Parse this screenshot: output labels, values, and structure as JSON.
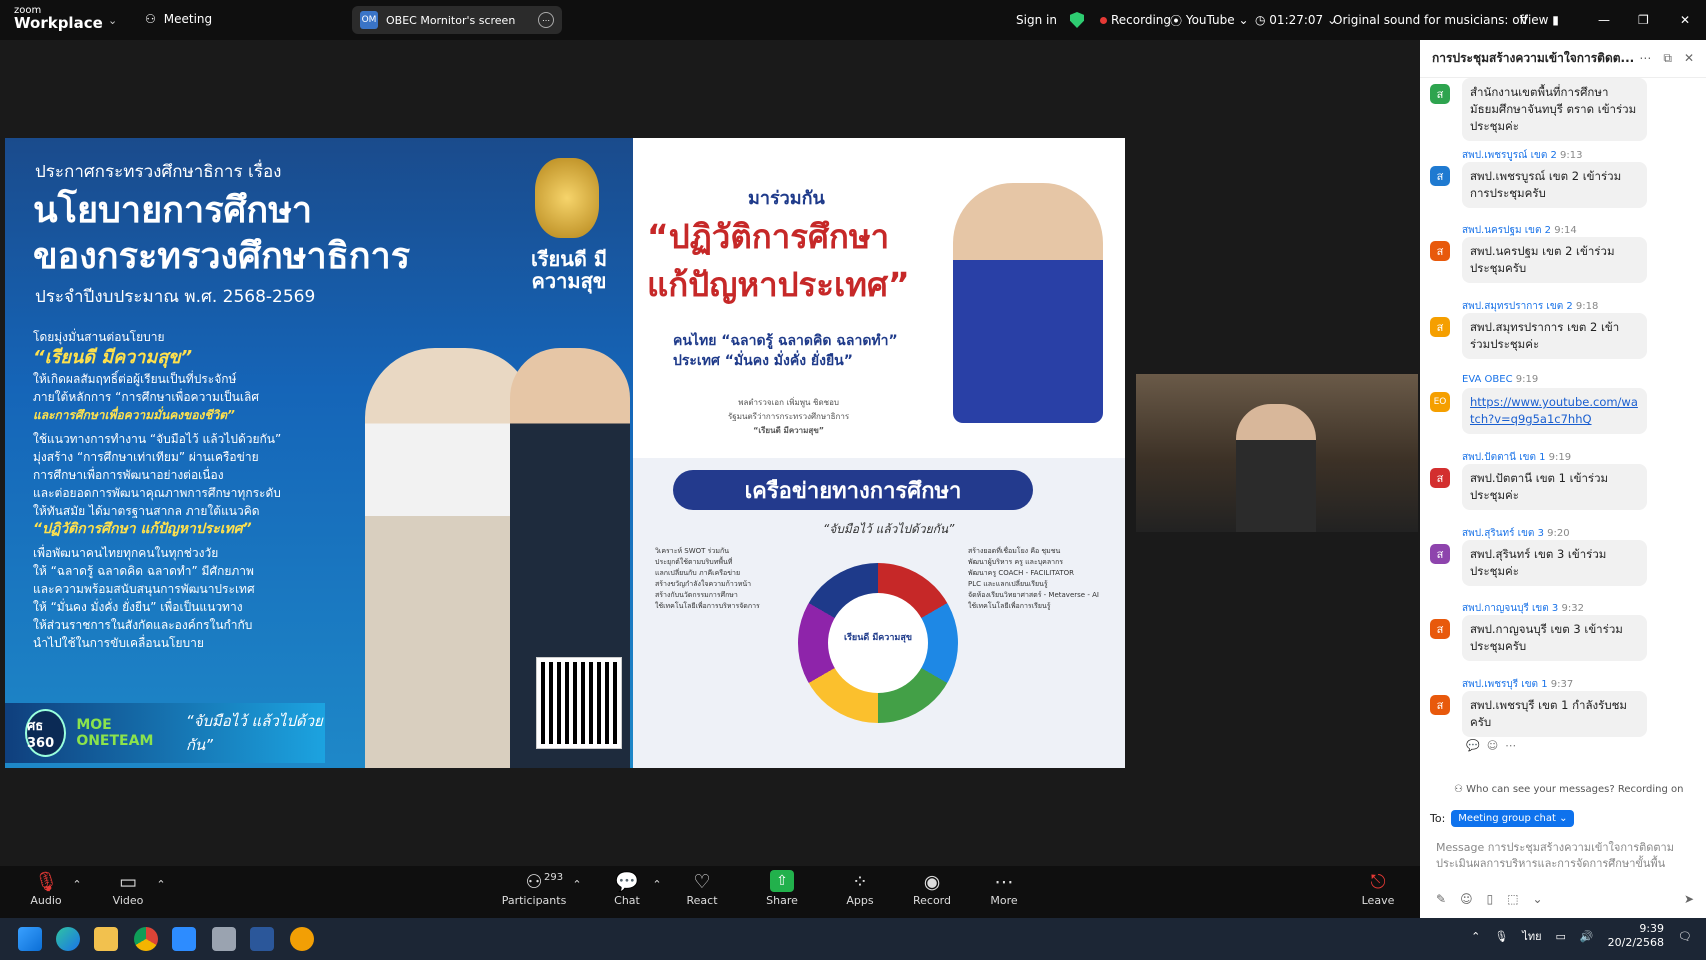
{
  "app": {
    "logo_top": "zoom",
    "logo_bottom": "Workplace",
    "meeting_label": "Meeting"
  },
  "share_pill": {
    "initials": "OM",
    "label": "OBEC Mornitor's screen"
  },
  "top_right": {
    "sign_in": "Sign in",
    "recording": "Recording",
    "youtube": "YouTube",
    "timer": "01:27:07",
    "sound": "Original sound for musicians: off",
    "view": "View"
  },
  "slide": {
    "left_title": "ประกาศกระทรวงศึกษาธิการ เรื่อง",
    "left_heading_1": "นโยบายการศึกษา",
    "left_heading_2": "ของกระทรวงศึกษาธิการ",
    "left_year": "ประจำปีงบประมาณ พ.ศ. 2568-2569",
    "emblem_text": "เรียนดี มีความสุข",
    "left_body": [
      "โดยมุ่งมั่นสานต่อนโยบาย",
      "“เรียนดี มีความสุข”",
      "ให้เกิดผลสัมฤทธิ์ต่อผู้เรียนเป็นที่ประจักษ์",
      "ภายใต้หลักการ “การศึกษาเพื่อความเป็นเลิศ",
      "และการศึกษาเพื่อความมั่นคงของชีวิต”",
      "ใช้แนวทางการทำงาน “จับมือไว้ แล้วไปด้วยกัน”",
      "มุ่งสร้าง “การศึกษาเท่าเทียม” ผ่านเครือข่าย",
      "การศึกษาเพื่อการพัฒนาอย่างต่อเนื่อง",
      "และต่อยอดการพัฒนาคุณภาพการศึกษาทุกระดับ",
      "ให้ทันสมัย ได้มาตรฐานสากล ภายใต้แนวคิด",
      "“ปฏิวัติการศึกษา แก้ปัญหาประเทศ”",
      "เพื่อพัฒนาคนไทยทุกคนในทุกช่วงวัย",
      "ให้ “ฉลาดรู้ ฉลาดคิด ฉลาดทำ” มีศักยภาพ",
      "และความพร้อมสนับสนุนการพัฒนาประเทศ",
      "ให้ “มั่นคง มั่งคั่ง ยั่งยืน” เพื่อเป็นแนวทาง",
      "ให้ส่วนราชการในสังกัดและองค์กรในกำกับ",
      "นำไปใช้ในการขับเคลื่อนนโยบาย"
    ],
    "strip_circle": "ศธ 360",
    "strip_moe": "MOE ONETEAM",
    "strip_quote": "“จับมือไว้ แล้วไปด้วยกัน”",
    "right_a": "มาร่วมกัน",
    "right_b1": "“ปฏิวัติการศึกษา",
    "right_b2": "แก้ปัญหาประเทศ”",
    "right_c1": "คนไทย  “ฉลาดรู้ ฉลาดคิด ฉลาดทำ”",
    "right_c2": "ประเทศ  “มั่นคง มั่งคั่ง ยั่งยืน”",
    "right_d1": "พลตำรวจเอก เพิ่มพูน ชิดชอบ",
    "right_d2": "รัฐมนตรีว่าการกระทรวงศึกษาธิการ",
    "right_d3": "“เรียนดี มีความสุข”",
    "network_banner": "เครือข่ายทางการศึกษา",
    "network_sub": "“จับมือไว้ แล้วไปด้วยกัน”",
    "wheel_center": "เรียนดี มีความสุข",
    "bullets_left": [
      "วิเคราะห์ SWOT ร่วมกัน",
      "ประยุกต์ใช้ตามบริบทพื้นที่",
      "แลกเปลี่ยนกับ ภาคีเครือข่าย",
      "สร้างขวัญกำลังใจความก้าวหน้า",
      "สร้างกับนวัตกรรมการศึกษา",
      "ใช้เทคโนโลยีเพื่อการบริหารจัดการ"
    ],
    "bullets_right": [
      "สร้างยอดที่เชื่อมโยง คือ ชุมชน",
      "พัฒนาผู้บริหาร ครู และบุคลากร",
      "พัฒนาครู COACH - FACILITATOR",
      "PLC และแลกเปลี่ยนเรียนรู้",
      "จัดห้องเรียนวิทยาศาสตร์ - Metaverse - AI",
      "ใช้เทคโนโลยีเพื่อการเรียนรู้"
    ]
  },
  "chat": {
    "title": "การประชุมสร้างความเข้าใจการติดต...",
    "messages": [
      {
        "initial": "ส",
        "color": "#2ea44f",
        "name": "",
        "time": "",
        "text": "สำนักงานเขตพื้นที่การศึกษามัธยมศึกษาจันทบุรี ตราด เข้าร่วมประชุมค่ะ"
      },
      {
        "initial": "ส",
        "color": "#1f7ad1",
        "name": "สพป.เพชรบูรณ์ เขต 2",
        "time": "9:13",
        "text": "สพป.เพชรบูรณ์ เขต 2 เข้าร่วมการประชุมครับ"
      },
      {
        "initial": "ส",
        "color": "#e8590c",
        "name": "สพป.นครปฐม เขต 2",
        "time": "9:14",
        "text": "สพป.นครปฐม เขต 2 เข้าร่วมประชุมครับ"
      },
      {
        "initial": "ส",
        "color": "#f59f00",
        "name": "สพป.สมุทรปราการ เขต 2",
        "time": "9:18",
        "text": "สพป.สมุทรปราการ เขต 2 เข้าร่วมประชุมค่ะ"
      },
      {
        "initial": "EO",
        "color": "#f59f00",
        "name": "EVA OBEC",
        "time": "9:19",
        "text": "https://www.youtube.com/watch?v=q9g5a1c7hhQ"
      },
      {
        "initial": "ส",
        "color": "#d32f2f",
        "name": "สพป.ปัตตานี เขต 1",
        "time": "9:19",
        "text": "สพป.ปัตตานี เขต 1 เข้าร่วมประชุมค่ะ"
      },
      {
        "initial": "ส",
        "color": "#8e44ad",
        "name": "สพป.สุรินทร์ เขต 3",
        "time": "9:20",
        "text": "สพป.สุรินทร์ เขต 3 เข้าร่วมประชุมค่ะ"
      },
      {
        "initial": "ส",
        "color": "#e8590c",
        "name": "สพป.กาญจนบุรี เขต 3",
        "time": "9:32",
        "text": "สพป.กาญจนบุรี เขต 3 เข้าร่วมประชุมครับ"
      },
      {
        "initial": "ส",
        "color": "#e8590c",
        "name": "สพป.เพชรบุรี เขต 1",
        "time": "9:37",
        "text": "สพป.เพชรบุรี เขต 1 กำลังรับชมครับ"
      }
    ],
    "info": "Who can see your messages? Recording on",
    "to_label": "To:",
    "to_target": "Meeting group chat",
    "compose_placeholder": "Message การประชุมสร้างความเข้าใจการติดตามประเมินผลการบริหารและการจัดการศึกษาขั้นพื้น"
  },
  "bottom": {
    "audio": "Audio",
    "video": "Video",
    "participants": "Participants",
    "participants_count": "293",
    "chat": "Chat",
    "react": "React",
    "share": "Share",
    "apps": "Apps",
    "record": "Record",
    "more": "More",
    "leave": "Leave"
  },
  "taskbar": {
    "lang": "ไทย",
    "time": "9:39",
    "date": "20/2/2568"
  }
}
